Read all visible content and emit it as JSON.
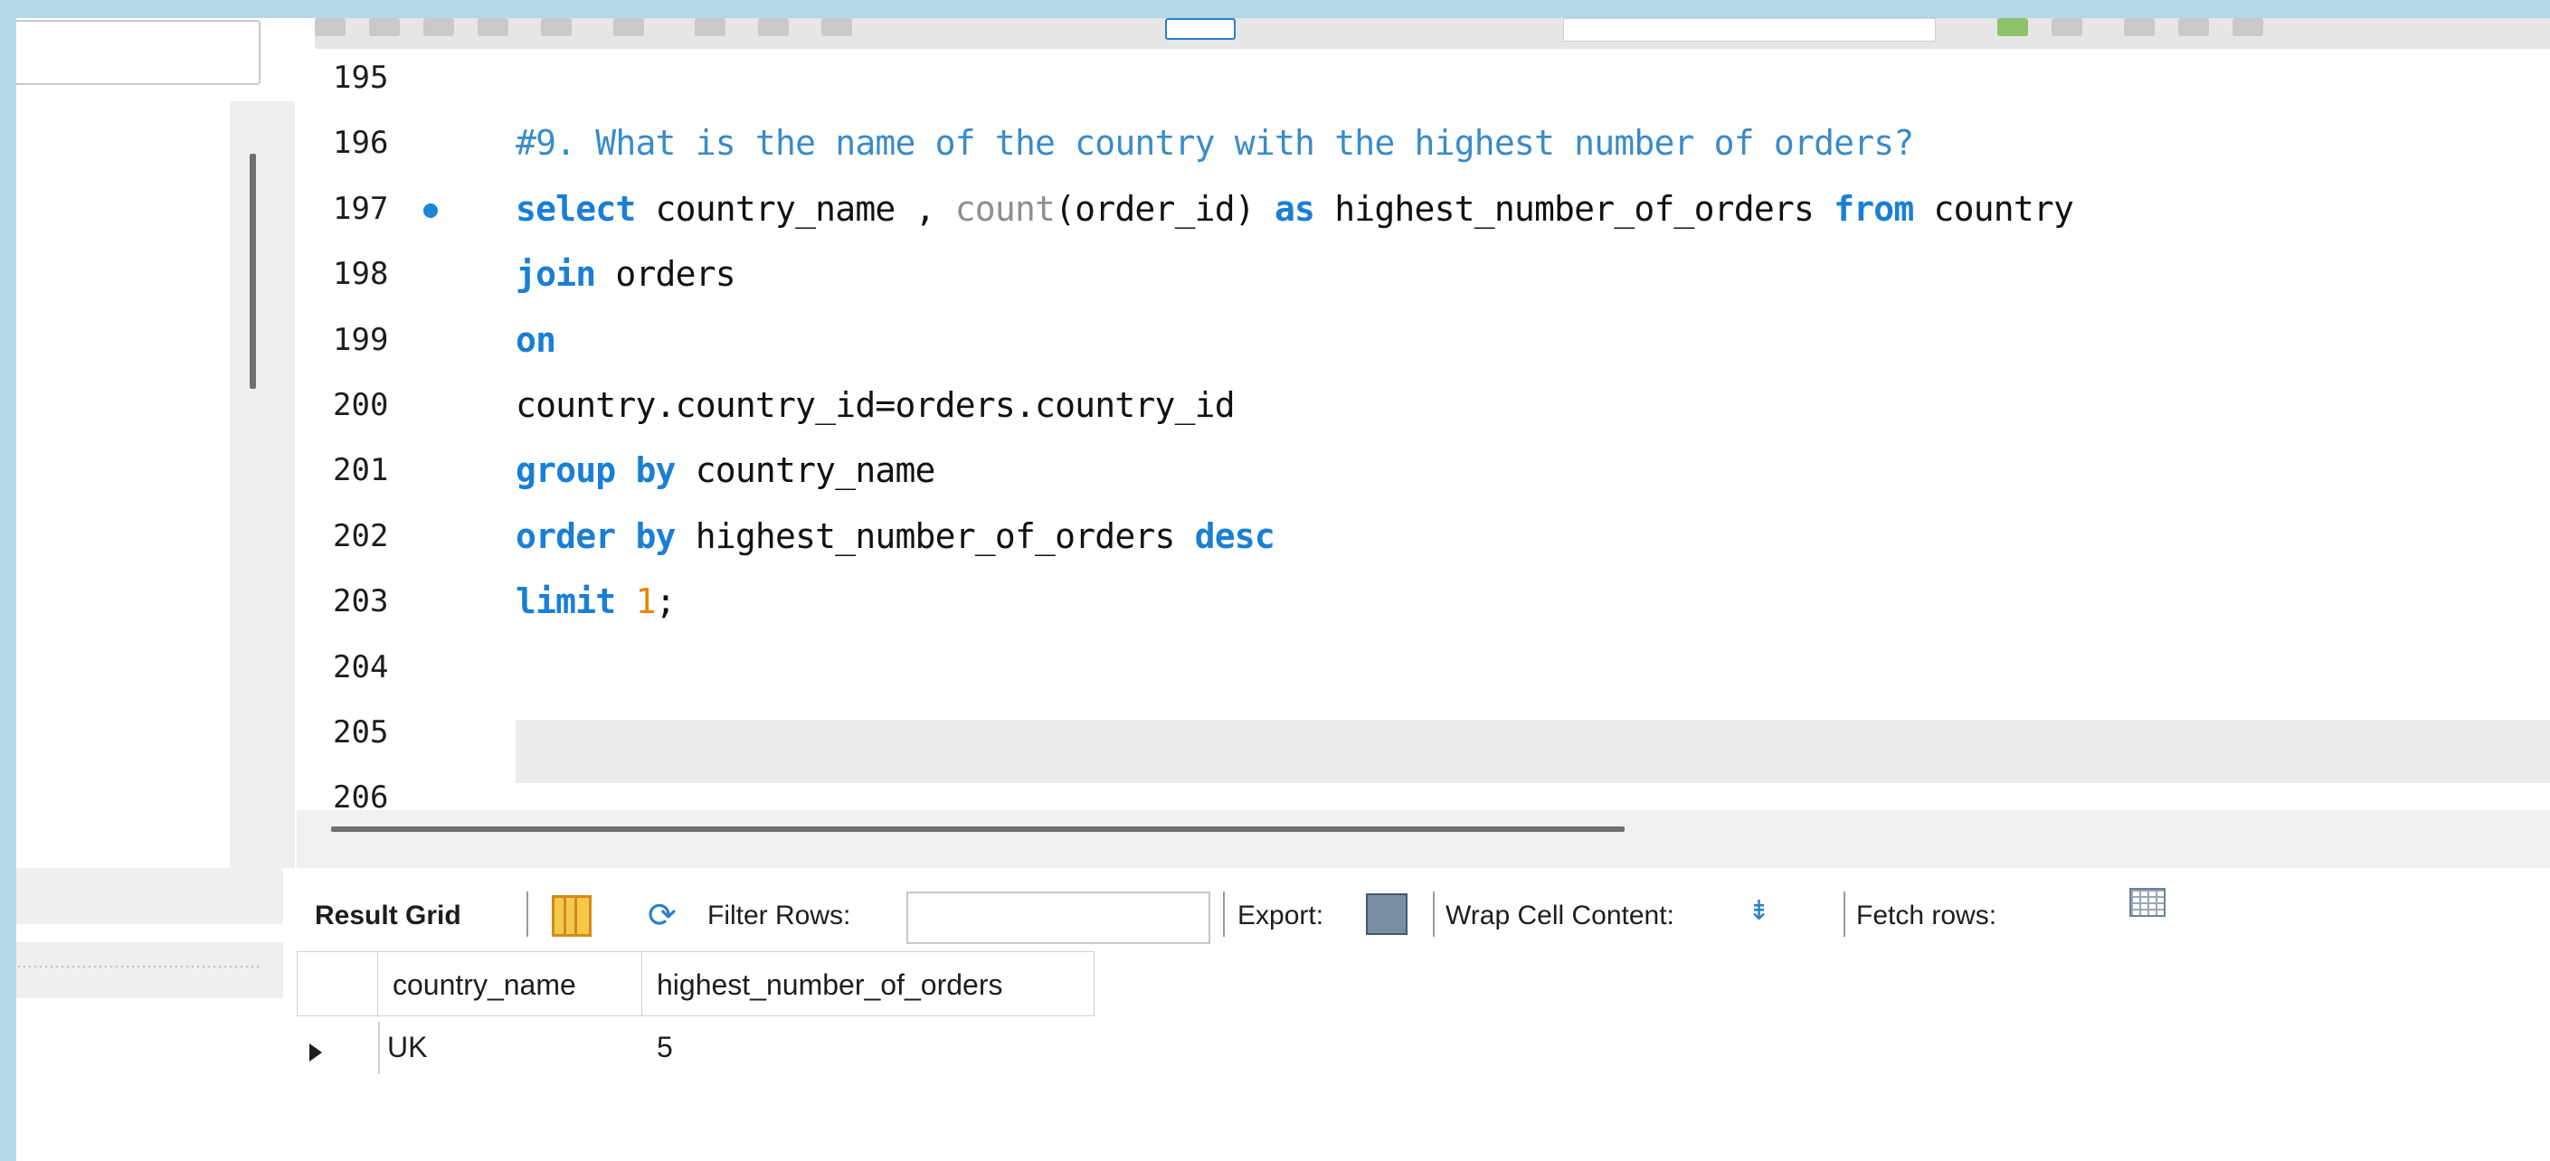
{
  "editor": {
    "lines": [
      {
        "num": "195",
        "tokens": []
      },
      {
        "num": "196",
        "tokens": [
          {
            "t": "#9. What is the name of the country with the highest number of orders?",
            "c": "comment"
          }
        ]
      },
      {
        "num": "197",
        "marker": true,
        "tokens": [
          {
            "t": "select",
            "c": "kw"
          },
          {
            "t": " country_name , ",
            "c": "ident"
          },
          {
            "t": "count",
            "c": "fn"
          },
          {
            "t": "(order_id) ",
            "c": "ident"
          },
          {
            "t": "as",
            "c": "kw"
          },
          {
            "t": " highest_number_of_orders ",
            "c": "ident"
          },
          {
            "t": "from",
            "c": "kw"
          },
          {
            "t": " country",
            "c": "ident"
          }
        ]
      },
      {
        "num": "198",
        "tokens": [
          {
            "t": "join",
            "c": "kw"
          },
          {
            "t": " orders",
            "c": "ident"
          }
        ]
      },
      {
        "num": "199",
        "tokens": [
          {
            "t": "on",
            "c": "kw"
          }
        ]
      },
      {
        "num": "200",
        "tokens": [
          {
            "t": "country.country_id=orders.country_id",
            "c": "ident"
          }
        ]
      },
      {
        "num": "201",
        "tokens": [
          {
            "t": "group by",
            "c": "kw"
          },
          {
            "t": " country_name",
            "c": "ident"
          }
        ]
      },
      {
        "num": "202",
        "tokens": [
          {
            "t": "order by",
            "c": "kw"
          },
          {
            "t": " highest_number_of_orders ",
            "c": "ident"
          },
          {
            "t": "desc",
            "c": "kw"
          }
        ]
      },
      {
        "num": "203",
        "tokens": [
          {
            "t": "limit",
            "c": "kw"
          },
          {
            "t": " ",
            "c": "ident"
          },
          {
            "t": "1",
            "c": "num"
          },
          {
            "t": ";",
            "c": "ident"
          }
        ]
      },
      {
        "num": "204",
        "tokens": []
      },
      {
        "num": "205",
        "current": true,
        "tokens": []
      },
      {
        "num": "206",
        "tokens": []
      }
    ]
  },
  "result_toolbar": {
    "result_grid_label": "Result Grid",
    "filter_rows_label": "Filter Rows:",
    "filter_rows_value": "",
    "export_label": "Export:",
    "wrap_cell_label": "Wrap Cell Content:",
    "fetch_rows_label": "Fetch rows:"
  },
  "result_grid": {
    "columns": [
      "country_name",
      "highest_number_of_orders"
    ],
    "rows": [
      [
        "UK",
        "5"
      ]
    ]
  },
  "colors": {
    "keyword": "#1a7fd4",
    "comment": "#3a8bc9",
    "function": "#8f8f8f",
    "number": "#e8860c",
    "frame_border": "#b4d7e8"
  }
}
